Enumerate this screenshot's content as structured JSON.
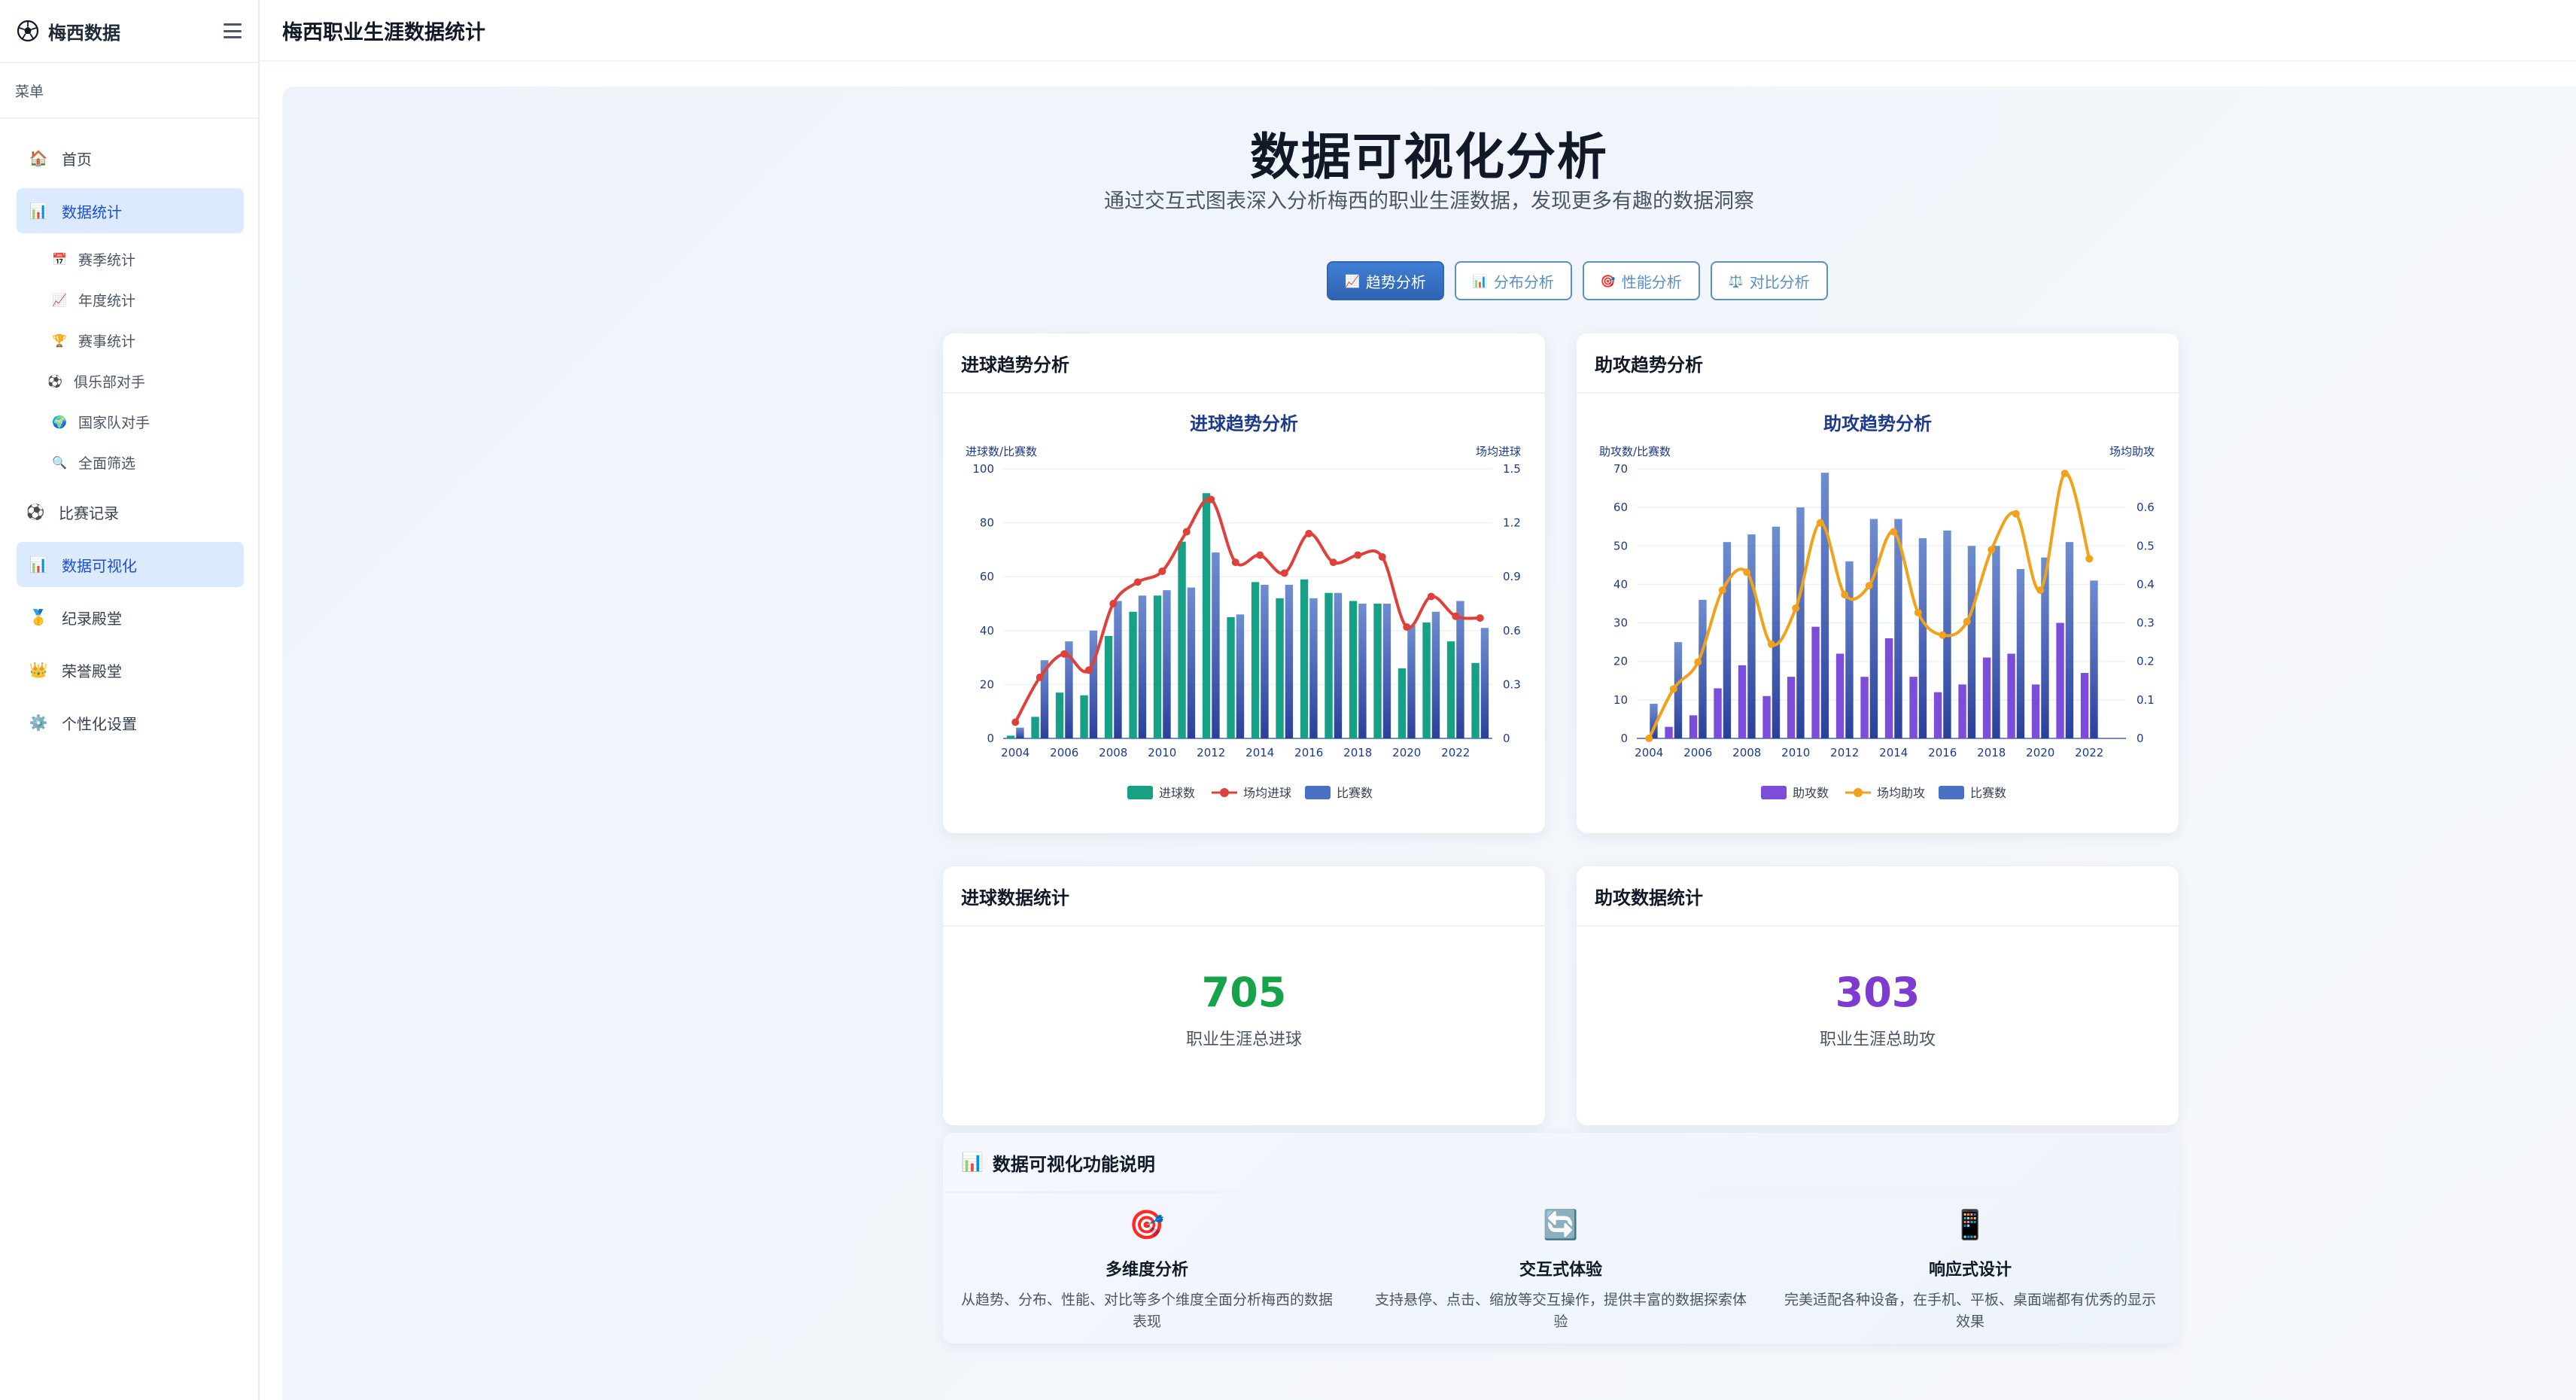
{
  "app": {
    "name": "梅西数据",
    "logo_icon": "soccer-ball-icon"
  },
  "header": {
    "title": "梅西职业生涯数据统计"
  },
  "sidebar": {
    "caption": "菜单",
    "items": [
      {
        "label": "首页",
        "icon": "🏠"
      },
      {
        "label": "数据统计",
        "icon": "📊"
      },
      {
        "label": "比赛记录",
        "icon": "⚽"
      },
      {
        "label": "数据可视化",
        "icon": "📊"
      },
      {
        "label": "纪录殿堂",
        "icon": "🥇"
      },
      {
        "label": "荣誉殿堂",
        "icon": "👑"
      },
      {
        "label": "个性化设置",
        "icon": "⚙️"
      }
    ],
    "sub_items": [
      {
        "label": "赛季统计",
        "icon": "📅"
      },
      {
        "label": "年度统计",
        "icon": "📈"
      },
      {
        "label": "赛事统计",
        "icon": "🏆"
      },
      {
        "label": "俱乐部对手",
        "icon": "⚽"
      },
      {
        "label": "国家队对手",
        "icon": "🌍"
      },
      {
        "label": "全面筛选",
        "icon": "🔍"
      }
    ]
  },
  "hero": {
    "title": "数据可视化分析",
    "subtitle": "通过交互式图表深入分析梅西的职业生涯数据，发现更多有趣的数据洞察"
  },
  "tabs": [
    {
      "label": "趋势分析",
      "icon": "📈"
    },
    {
      "label": "分布分析",
      "icon": "📊"
    },
    {
      "label": "性能分析",
      "icon": "🎯"
    },
    {
      "label": "对比分析",
      "icon": "⚖️"
    }
  ],
  "cards": {
    "goals_trend": "进球趋势分析",
    "assists_trend": "助攻趋势分析",
    "goals_stats": "进球数据统计",
    "assists_stats": "助攻数据统计"
  },
  "stats": {
    "goals": {
      "value": "705",
      "label": "职业生涯总进球",
      "color": "#16a34a"
    },
    "assists": {
      "value": "303",
      "label": "职业生涯总助攻",
      "color": "#7e3bd1"
    }
  },
  "features": {
    "title": "数据可视化功能说明",
    "title_icon": "📊",
    "items": [
      {
        "icon": "🎯",
        "title": "多维度分析",
        "desc": "从趋势、分布、性能、对比等多个维度全面分析梅西的数据表现"
      },
      {
        "icon": "🔄",
        "title": "交互式体验",
        "desc": "支持悬停、点击、缩放等交互操作，提供丰富的数据探索体验"
      },
      {
        "icon": "📱",
        "title": "响应式设计",
        "desc": "完美适配各种设备，在手机、平板、桌面端都有优秀的显示效果"
      }
    ]
  },
  "chart_data": [
    {
      "type": "bar",
      "title": "进球趋势分析",
      "ylabel": "进球数/比赛数",
      "y2label": "场均进球",
      "ylim": [
        0,
        100
      ],
      "y2lim": [
        0,
        1.5
      ],
      "yticks": [
        0,
        20,
        40,
        60,
        80,
        100
      ],
      "y2ticks": [
        "0",
        "0.3",
        "0.6",
        "0.9",
        "1.2",
        "1.5"
      ],
      "xticks": [
        "2004",
        "2006",
        "2008",
        "2010",
        "2012",
        "2014",
        "2016",
        "2018",
        "2020",
        "2022"
      ],
      "x": [
        2004,
        2005,
        2006,
        2007,
        2008,
        2009,
        2010,
        2011,
        2012,
        2013,
        2014,
        2015,
        2016,
        2017,
        2018,
        2019,
        2020,
        2021,
        2022,
        2023
      ],
      "colors": {
        "bar1": "#16a085",
        "line": "#e0403a",
        "bar2": "#4a70c4"
      },
      "series": [
        {
          "name": "进球数",
          "kind": "bar",
          "values": [
            1,
            8,
            17,
            16,
            38,
            47,
            53,
            73,
            91,
            45,
            58,
            52,
            59,
            54,
            51,
            50,
            26,
            43,
            36,
            28
          ]
        },
        {
          "name": "场均进球",
          "kind": "line",
          "values": [
            0.09,
            0.34,
            0.47,
            0.38,
            0.75,
            0.87,
            0.93,
            1.15,
            1.33,
            0.98,
            1.02,
            0.92,
            1.14,
            0.98,
            1.02,
            1.01,
            0.62,
            0.79,
            0.68,
            0.67
          ]
        },
        {
          "name": "比赛数",
          "kind": "bar",
          "values": [
            4,
            29,
            36,
            40,
            51,
            53,
            55,
            56,
            69,
            46,
            57,
            57,
            52,
            54,
            50,
            50,
            42,
            47,
            51,
            41
          ]
        }
      ]
    },
    {
      "type": "bar",
      "title": "助攻趋势分析",
      "ylabel": "助攻数/比赛数",
      "y2label": "场均助攻",
      "ylim": [
        0,
        70
      ],
      "y2lim": [
        0,
        0.6
      ],
      "yticks": [
        0,
        10,
        20,
        30,
        40,
        50,
        60,
        70
      ],
      "y2ticks": [
        "0",
        "0.1",
        "0.2",
        "0.3",
        "0.4",
        "0.5",
        "0.6"
      ],
      "xticks": [
        "2004",
        "2006",
        "2008",
        "2010",
        "2012",
        "2014",
        "2016",
        "2018",
        "2020",
        "2022"
      ],
      "x": [
        2004,
        2005,
        2006,
        2007,
        2008,
        2009,
        2010,
        2011,
        2012,
        2013,
        2014,
        2015,
        2016,
        2017,
        2018,
        2019,
        2020,
        2021,
        2022,
        2023
      ],
      "colors": {
        "bar1": "#7c4ddb",
        "line": "#f0a21a",
        "bar2": "#4a70c4"
      },
      "series": [
        {
          "name": "助攻数",
          "kind": "bar",
          "values": [
            0,
            3,
            6,
            13,
            19,
            11,
            16,
            29,
            22,
            16,
            26,
            16,
            12,
            14,
            21,
            22,
            14,
            30,
            17,
            0
          ]
        },
        {
          "name": "场均助攻",
          "kind": "line",
          "values": [
            0,
            0.11,
            0.17,
            0.33,
            0.37,
            0.21,
            0.29,
            0.48,
            0.32,
            0.34,
            0.46,
            0.28,
            0.23,
            0.26,
            0.42,
            0.5,
            0.33,
            0.59,
            0.4,
            0
          ]
        },
        {
          "name": "比赛数",
          "kind": "bar",
          "values": [
            9,
            25,
            36,
            51,
            53,
            55,
            60,
            69,
            46,
            57,
            57,
            52,
            54,
            50,
            50,
            44,
            47,
            51,
            41,
            0
          ]
        }
      ]
    }
  ]
}
